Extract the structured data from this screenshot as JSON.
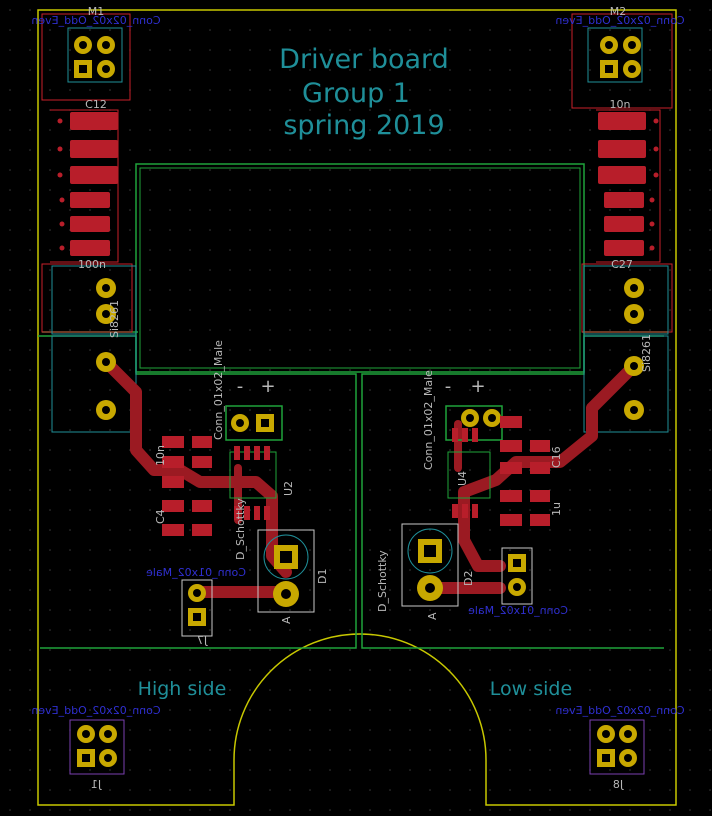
{
  "board": {
    "title_lines": [
      "Driver board",
      "Group 1",
      "spring 2019"
    ],
    "high_side_label": "High side",
    "low_side_label": "Low side"
  },
  "refs": {
    "m1": "M1",
    "m2": "M2",
    "j1": "J1",
    "j8": "J8",
    "c12": "C12",
    "c27": "C27",
    "cap_10n_top": "10n",
    "cap_100n_left": "100n",
    "c4": "C4",
    "c16": "C16",
    "cap_10n_left": "10n",
    "cap_1u_right": "1u",
    "d1": "D1",
    "d2": "D2",
    "u2": "U2",
    "u4": "U4",
    "anode_left": "A",
    "anode_right": "A",
    "j7": "J7"
  },
  "values": {
    "conn_top_left": "Conn_02x02_Odd_Even",
    "conn_top_right": "Conn_02x02_Odd_Even",
    "conn_bottom_left": "Conn_02x02_Odd_Even",
    "conn_bottom_right": "Conn_02x02_Odd_Even",
    "conn_mid_left": "Conn_01x02_Male",
    "conn_mid_right": "Conn_01x02_Male",
    "schottky_left": "D_Schottky",
    "schottky_right": "D_Schottky",
    "conn_01x02_male_top_left": "Conn_01x02_Male",
    "conn_01x02_male_top_right": "Conn_01x02_Male",
    "si_left": "Si8261",
    "si_right": "Si8261",
    "minus_left": "-",
    "plus_left": "+",
    "minus_right": "-",
    "plus_right": "+"
  },
  "colors": {
    "background": "#000000",
    "board_edge": "#c8c800",
    "zone_outline": "#1fa33a",
    "copper_pad": "#c8a800",
    "copper_trace": "#9b1a22",
    "smd_pad": "#b81e2a",
    "silk_text": "#1f8f99",
    "silk_white": "#b8b8b8",
    "fab_blue": "#2f2fd0",
    "courtyard_red": "#c8202a",
    "grid_dot": "#3a3a3a"
  }
}
